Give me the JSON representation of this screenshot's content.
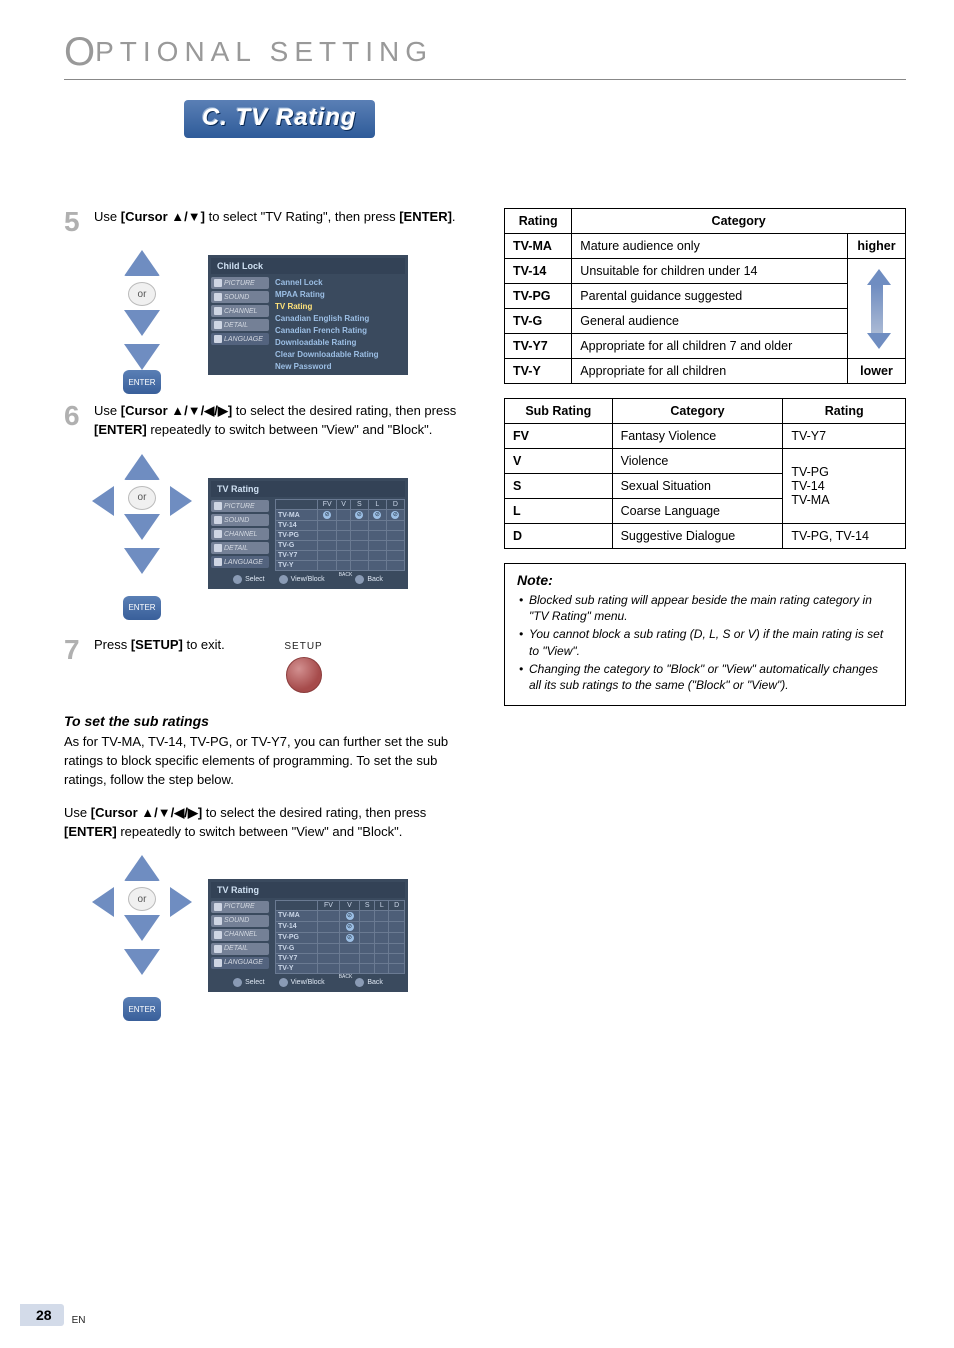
{
  "header": {
    "cap": "O",
    "title": "PTIONAL  SETTING"
  },
  "section_label": "C. TV Rating",
  "step5": {
    "num": "5",
    "pre": "Use ",
    "cmd": "[Cursor ▲/▼]",
    "mid": " to select \"TV Rating\", then press ",
    "cmd2": "[ENTER]",
    "post": "."
  },
  "step6": {
    "num": "6",
    "pre": "Use ",
    "cmd": "[Cursor ▲/▼/◀/▶]",
    "mid": " to select the desired rating, then press ",
    "cmd2": "[ENTER]",
    "post": " repeatedly to switch between \"View\" and \"Block\"."
  },
  "step7": {
    "num": "7",
    "pre": "Press ",
    "cmd": "[SETUP]",
    "post": " to exit."
  },
  "pad_or": "or",
  "pad_enter": "ENTER",
  "setup_label": "SETUP",
  "sub_heading": "To set the sub ratings",
  "sub_para1": "As for TV-MA, TV-14, TV-PG, or TV-Y7, you can further set the sub ratings to block specific elements of programming. To set the sub ratings, follow the step below.",
  "sub_para2_pre": "Use ",
  "sub_para2_cmd": "[Cursor ▲/▼/◀/▶]",
  "sub_para2_mid": " to select the desired rating, then press ",
  "sub_para2_cmd2": "[ENTER]",
  "sub_para2_post": " repeatedly to switch between \"View\" and \"Block\".",
  "osd1": {
    "header": "Child Lock",
    "tabs": [
      "PICTURE",
      "SOUND",
      "CHANNEL",
      "DETAIL",
      "LANGUAGE"
    ],
    "items": [
      "Cannel Lock",
      "MPAA Rating",
      "TV Rating",
      "Canadian English Rating",
      "Canadian French Rating",
      "Downloadable Rating",
      "Clear Downloadable Rating",
      "New Password"
    ]
  },
  "osd2": {
    "header": "TV Rating",
    "tabs": [
      "PICTURE",
      "SOUND",
      "CHANNEL",
      "DETAIL",
      "LANGUAGE"
    ],
    "cols": [
      "FV",
      "V",
      "S",
      "L",
      "D"
    ],
    "rows": [
      "TV-MA",
      "TV-14",
      "TV-PG",
      "TV-G",
      "TV-Y7",
      "TV-Y"
    ],
    "footer": {
      "select": "Select",
      "viewblock": "View/Block",
      "back_sup": "BACK",
      "back": "Back"
    }
  },
  "rating_table": {
    "th": [
      "Rating",
      "Category"
    ],
    "higher": "higher",
    "lower": "lower",
    "rows": [
      {
        "code": "TV-MA",
        "desc": "Mature audience only"
      },
      {
        "code": "TV-14",
        "desc": "Unsuitable for children under 14"
      },
      {
        "code": "TV-PG",
        "desc": "Parental guidance suggested"
      },
      {
        "code": "TV-G",
        "desc": "General audience"
      },
      {
        "code": "TV-Y7",
        "desc": "Appropriate for all children 7 and older"
      },
      {
        "code": "TV-Y",
        "desc": "Appropriate for all children"
      }
    ]
  },
  "subrating_table": {
    "th": [
      "Sub Rating",
      "Category",
      "Rating"
    ],
    "rows": [
      {
        "code": "FV",
        "desc": "Fantasy Violence"
      },
      {
        "code": "V",
        "desc": "Violence"
      },
      {
        "code": "S",
        "desc": "Sexual Situation"
      },
      {
        "code": "L",
        "desc": "Coarse Language"
      },
      {
        "code": "D",
        "desc": "Suggestive Dialogue"
      }
    ],
    "rating_cells": [
      "TV-Y7",
      "TV-PG\nTV-14\nTV-MA",
      "TV-PG, TV-14"
    ]
  },
  "note": {
    "title": "Note:",
    "items": [
      "Blocked sub rating will appear beside the main rating category in \"TV Rating\" menu.",
      "You cannot block a sub rating (D, L, S or V) if the main rating is set to \"View\".",
      "Changing the category to \"Block\" or \"View\" automatically changes all its sub ratings to the same (\"Block\" or \"View\")."
    ]
  },
  "page_number": "28",
  "page_lang": "EN"
}
